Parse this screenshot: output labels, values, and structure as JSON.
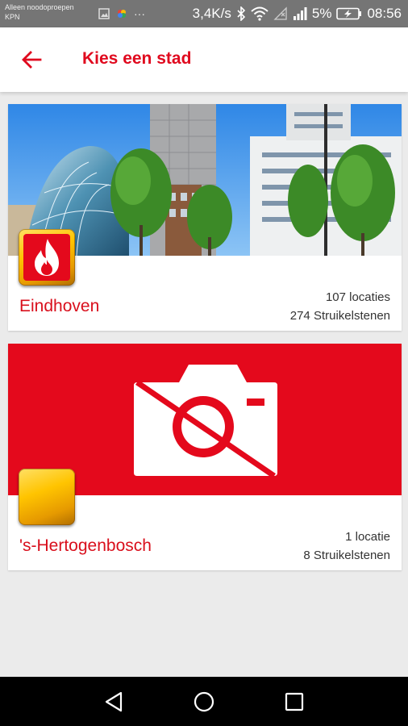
{
  "status_bar": {
    "carrier_line1": "Alleen noodoproepen",
    "carrier_line2": "KPN",
    "more": "···",
    "speed": "3,4K/s",
    "battery_percent": "5%",
    "time": "08:56",
    "icons": [
      "image-icon",
      "photos-icon",
      "bluetooth-icon",
      "wifi-icon",
      "no-sim-icon",
      "signal-icon",
      "battery-charging-icon"
    ]
  },
  "app_bar": {
    "title": "Kies een stad",
    "back_icon": "arrow-back-icon",
    "accent_color": "#e0091e"
  },
  "cities": [
    {
      "name": "Eindhoven",
      "locations": "107 locaties",
      "stones": "274 Struikelstenen",
      "image": "photo of Eindhoven city center with glass blob building and trees",
      "badge_icon": "flame-icon"
    },
    {
      "name": "'s-Hertogenbosch",
      "locations": "1 locatie",
      "stones": "8 Struikelstenen",
      "image": "no-photo placeholder",
      "badge_icon": "blank"
    }
  ],
  "nav_bar": {
    "icons": [
      "back-triangle-icon",
      "home-circle-icon",
      "recents-square-icon"
    ]
  }
}
